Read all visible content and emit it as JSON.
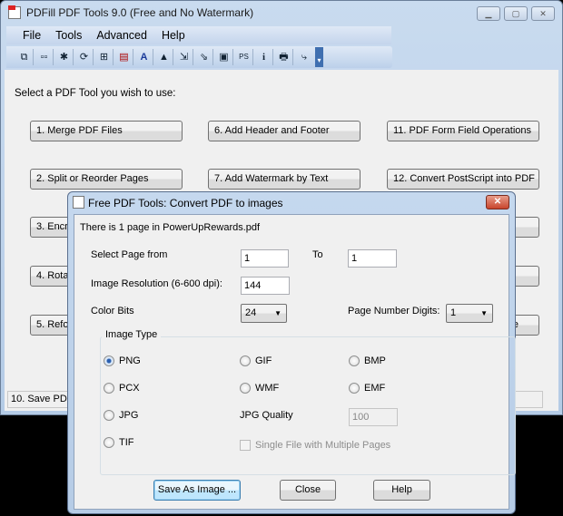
{
  "window": {
    "title": "PDFill PDF Tools 9.0 (Free and No Watermark)",
    "controls": [
      "minimize",
      "maximize",
      "close"
    ]
  },
  "menu": [
    "File",
    "Tools",
    "Advanced",
    "Help"
  ],
  "toolbar": [
    "merge-icon",
    "split-icon",
    "encrypt-icon",
    "rotate-icon",
    "reformat-icon",
    "header-footer-icon",
    "watermark-text-icon",
    "watermark-image-icon",
    "pdf-to-image-icon",
    "image-to-pdf-icon",
    "form-field-icon",
    "postscript-icon",
    "info-icon",
    "scan-icon",
    "image-convert-icon"
  ],
  "prompt": "Select a PDF Tool you wish to use:",
  "tools": [
    [
      "1. Merge PDF Files",
      "6. Add Header and Footer",
      "11. PDF Form Field Operations"
    ],
    [
      "2. Split or Reorder Pages",
      "7. Add Watermark by Text",
      "12. Convert PostScript into PDF"
    ],
    [
      "3. Encry",
      "",
      ""
    ],
    [
      "4. Rotat",
      "",
      ""
    ],
    [
      "5. Refor",
      "",
      "e"
    ]
  ],
  "status": "10. Save PDF",
  "dialog": {
    "title": "Free PDF Tools: Convert PDF to images",
    "info": "There is 1 page in PowerUpRewards.pdf",
    "page_from_label": "Select Page from",
    "page_from": "1",
    "to_label": "To",
    "page_to": "1",
    "resolution_label": "Image Resolution (6-600 dpi):",
    "resolution": "144",
    "color_bits_label": "Color Bits",
    "color_bits": "24",
    "digits_label": "Page Number Digits:",
    "digits": "1",
    "image_type_label": "Image Type",
    "types": [
      "PNG",
      "GIF",
      "BMP",
      "PCX",
      "WMF",
      "EMF",
      "JPG",
      "TIF"
    ],
    "selected_type": "PNG",
    "jpg_quality_label": "JPG Quality",
    "jpg_quality": "100",
    "single_file_label": "Single File with Multiple Pages",
    "save_label": "Save As Image ...",
    "close_label": "Close",
    "help_label": "Help"
  }
}
